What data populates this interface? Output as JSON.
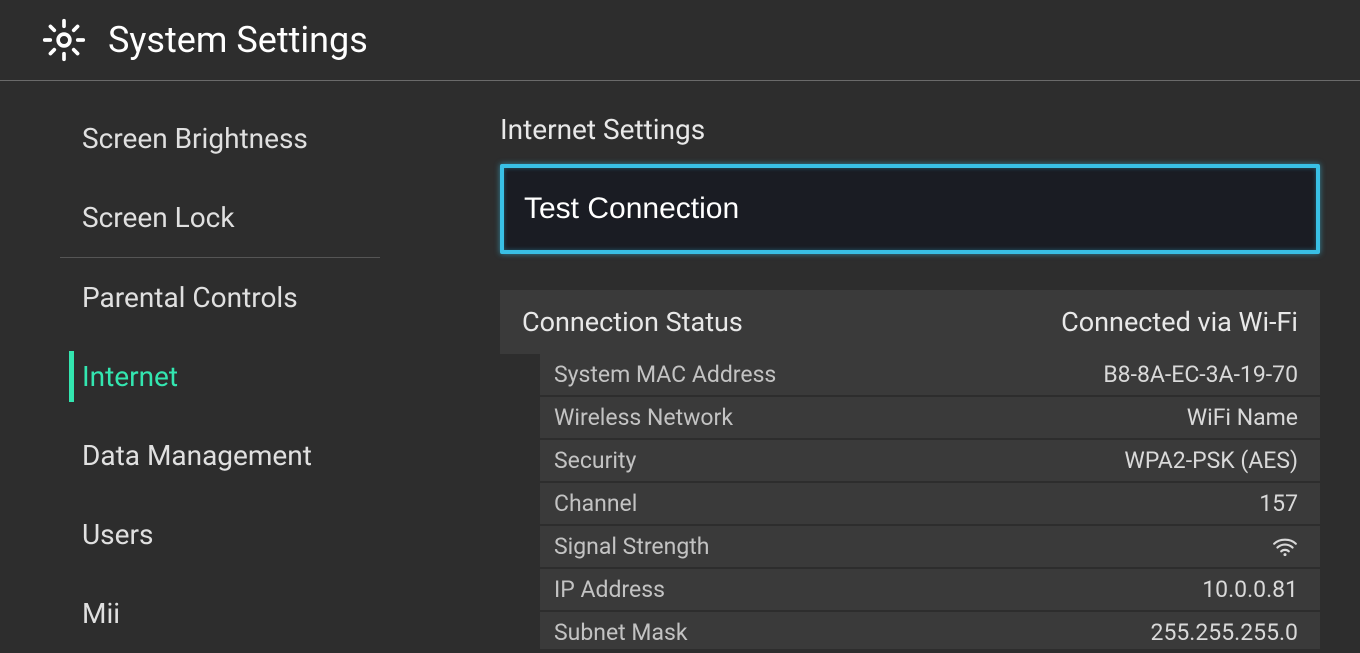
{
  "header": {
    "title": "System Settings"
  },
  "sidebar": {
    "items": [
      {
        "label": "Screen Brightness"
      },
      {
        "label": "Screen Lock"
      },
      {
        "label": "Parental Controls"
      },
      {
        "label": "Internet"
      },
      {
        "label": "Data Management"
      },
      {
        "label": "Users"
      },
      {
        "label": "Mii"
      }
    ],
    "active_index": 3,
    "divider_after_index": 1
  },
  "main": {
    "section_heading": "Internet Settings",
    "test_button_label": "Test Connection",
    "status_header_label": "Connection Status",
    "status_header_value": "Connected via Wi-Fi",
    "rows": [
      {
        "label": "System MAC Address",
        "value": "B8-8A-EC-3A-19-70"
      },
      {
        "label": "Wireless Network",
        "value": "WiFi Name"
      },
      {
        "label": "Security",
        "value": "WPA2-PSK (AES)"
      },
      {
        "label": "Channel",
        "value": "157"
      },
      {
        "label": "Signal Strength",
        "value_icon": "wifi-icon"
      },
      {
        "label": "IP Address",
        "value": "10.0.0.81"
      },
      {
        "label": "Subnet Mask",
        "value": "255.255.255.0"
      }
    ]
  }
}
